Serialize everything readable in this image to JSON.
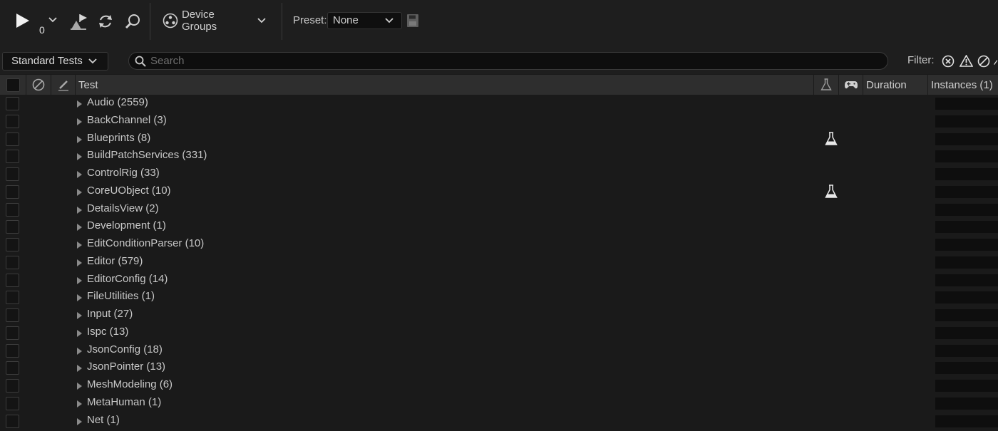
{
  "toolbar": {
    "run_count": "0",
    "device_groups_label": "Device Groups",
    "preset_label": "Preset:",
    "preset_value": "None"
  },
  "filterbar": {
    "test_type": "Standard Tests",
    "search_placeholder": "Search",
    "filter_label": "Filter:"
  },
  "columns": {
    "test": "Test",
    "duration": "Duration",
    "instances": "Instances (1)"
  },
  "tests": [
    {
      "label": "Audio (2559)",
      "flask": false
    },
    {
      "label": "BackChannel (3)",
      "flask": false
    },
    {
      "label": "Blueprints (8)",
      "flask": true
    },
    {
      "label": "BuildPatchServices (331)",
      "flask": false
    },
    {
      "label": "ControlRig (33)",
      "flask": false
    },
    {
      "label": "CoreUObject (10)",
      "flask": true
    },
    {
      "label": "DetailsView (2)",
      "flask": false
    },
    {
      "label": "Development (1)",
      "flask": false
    },
    {
      "label": "EditConditionParser (10)",
      "flask": false
    },
    {
      "label": "Editor (579)",
      "flask": false
    },
    {
      "label": "EditorConfig (14)",
      "flask": false
    },
    {
      "label": "FileUtilities (1)",
      "flask": false
    },
    {
      "label": "Input (27)",
      "flask": false
    },
    {
      "label": "Ispc (13)",
      "flask": false
    },
    {
      "label": "JsonConfig (18)",
      "flask": false
    },
    {
      "label": "JsonPointer (13)",
      "flask": false
    },
    {
      "label": "MeshModeling (6)",
      "flask": false
    },
    {
      "label": "MetaHuman (1)",
      "flask": false
    },
    {
      "label": "Net (1)",
      "flask": false
    }
  ],
  "colors": {
    "background": "#1a1a1a",
    "header": "#2e2e2e",
    "text": "#c8c8c8"
  }
}
